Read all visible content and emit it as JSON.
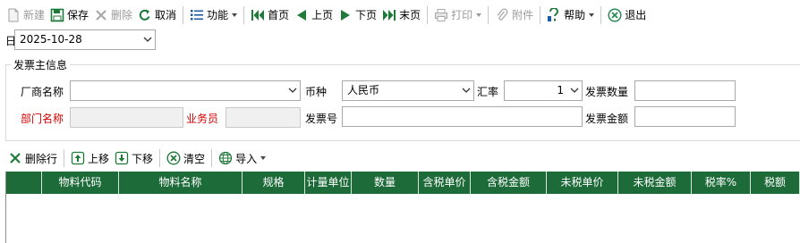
{
  "toolbar": {
    "new_label": "新建",
    "save_label": "保存",
    "delete_label": "删除",
    "cancel_label": "取消",
    "function_label": "功能",
    "first_label": "首页",
    "prev_label": "上页",
    "next_label": "下页",
    "last_label": "末页",
    "print_label": "打印",
    "attachment_label": "附件",
    "help_label": "帮助",
    "exit_label": "退出"
  },
  "date": {
    "label": "日期",
    "value": "2025-10-28"
  },
  "invoice_main": {
    "title": "发票主信息",
    "vendor_label": "厂商名称",
    "vendor_value": "",
    "currency_label": "币种",
    "currency_value": "人民币",
    "rate_label": "汇率",
    "rate_value": "1",
    "invoice_qty_label": "发票数量",
    "invoice_qty_value": "",
    "dept_label": "部门名称",
    "dept_value": "",
    "salesman_label": "业务员",
    "salesman_value": "",
    "invoice_no_label": "发票号",
    "invoice_no_value": "",
    "invoice_amount_label": "发票金额",
    "invoice_amount_value": ""
  },
  "grid_toolbar": {
    "delete_row_label": "删除行",
    "move_up_label": "上移",
    "move_down_label": "下移",
    "clear_label": "清空",
    "import_label": "导入"
  },
  "grid": {
    "columns": [
      "",
      "物料代码",
      "物料名称",
      "规格",
      "计量单位",
      "数量",
      "含税单价",
      "含税金额",
      "未税单价",
      "未税金额",
      "税率%",
      "税额"
    ]
  },
  "colors": {
    "grid_header_bg": "#1e6b3a",
    "required_label": "#d40000",
    "nav_green": "#1f7a3a",
    "exit_icon": "#2e8b57"
  }
}
